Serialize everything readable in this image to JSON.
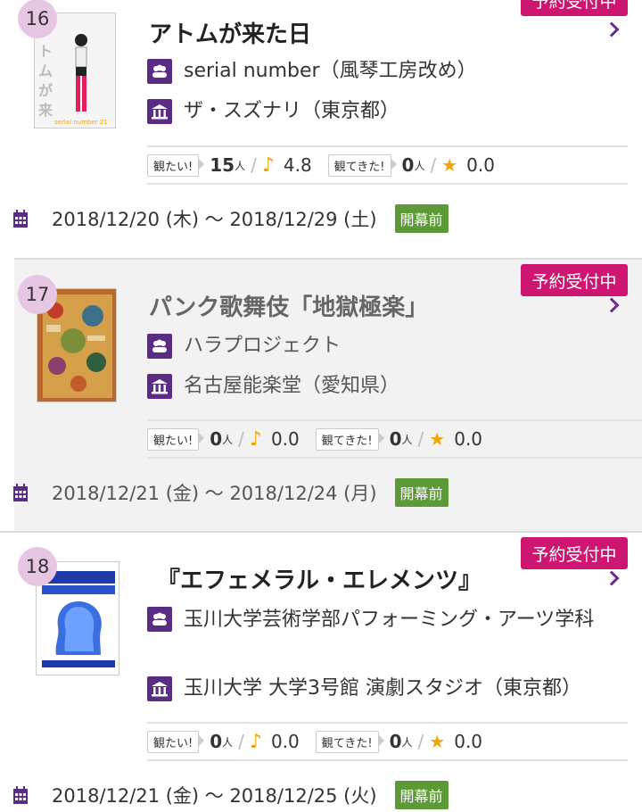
{
  "items": [
    {
      "rank": "16",
      "title": "アトムが来た日",
      "company": "serial number（風琴工房改め）",
      "venue": "ザ・スズナリ（東京都）",
      "reserve": "予約受付中",
      "want_label": "観たい!",
      "want_count": "15",
      "want_rating": "4.8",
      "seen_label": "観てきた!",
      "seen_count": "0",
      "seen_rating": "0.0",
      "unit": "人",
      "dates": "2018/12/20 (木) 〜 2018/12/29 (土)",
      "status": "開幕前"
    },
    {
      "rank": "17",
      "title": "パンク歌舞伎「地獄極楽」",
      "company": "ハラプロジェクト",
      "venue": "名古屋能楽堂（愛知県）",
      "reserve": "予約受付中",
      "want_label": "観たい!",
      "want_count": "0",
      "want_rating": "0.0",
      "seen_label": "観てきた!",
      "seen_count": "0",
      "seen_rating": "0.0",
      "unit": "人",
      "dates": "2018/12/21 (金) 〜 2018/12/24 (月)",
      "status": "開幕前"
    },
    {
      "rank": "18",
      "title": "『エフェメラル・エレメンツ』",
      "company": "玉川大学芸術学部パフォーミング・アーツ学科",
      "venue": "玉川大学 大学3号館 演劇スタジオ（東京都）",
      "reserve": "予約受付中",
      "want_label": "観たい!",
      "want_count": "0",
      "want_rating": "0.0",
      "seen_label": "観てきた!",
      "seen_count": "0",
      "seen_rating": "0.0",
      "unit": "人",
      "dates": "2018/12/21 (金) 〜 2018/12/25 (火)",
      "status": "開幕前"
    }
  ],
  "colors": {
    "accent_purple": "#5b2c83",
    "badge_magenta": "#cc1671",
    "status_green": "#5b9a36",
    "rank_circle": "#e6c6e3",
    "rating_gold": "#f0a500"
  },
  "icons": [
    "group-icon",
    "venue-icon",
    "calendar-icon",
    "music-note-icon",
    "star-icon",
    "chevron-right-icon"
  ]
}
